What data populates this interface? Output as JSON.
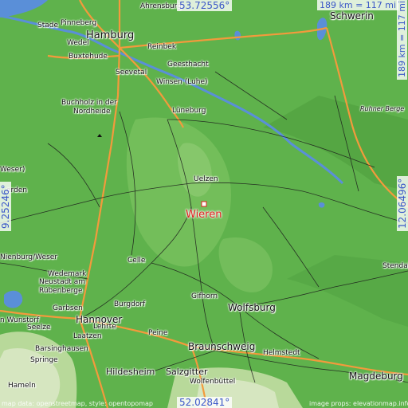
{
  "colors": {
    "land": "#5fb24c",
    "highland": "#8bc96a",
    "mountains": "#d6e6c0",
    "water": "#5a8fd8",
    "motorway": "#f39a3c",
    "road": "#1b1b1b",
    "accent": "#e0201c",
    "coord": "#3b57c8"
  },
  "location": {
    "name": "Wieren",
    "marker_icon": "square-marker-icon"
  },
  "coordinates": {
    "north": "53.72556°",
    "south": "52.02841°",
    "west": "9.25246°",
    "east": "12.06496°"
  },
  "scale": {
    "horizontal": "189 km = 117 mi",
    "vertical": "189 km = 117 mi"
  },
  "attribution": {
    "left": "map data: openstreetmap, style: opentopomap",
    "right": "image props: elevationmap.info"
  },
  "places": [
    {
      "name": "Ahrensburg",
      "size": "s9"
    },
    {
      "name": "Stade",
      "size": "s9"
    },
    {
      "name": "Pinneberg",
      "size": "s9"
    },
    {
      "name": "Hamburg",
      "size": "s13"
    },
    {
      "name": "Schwerin",
      "size": "s12"
    },
    {
      "name": "Wedel",
      "size": "s9"
    },
    {
      "name": "Buxtehude",
      "size": "s9"
    },
    {
      "name": "Reinbek",
      "size": "s9"
    },
    {
      "name": "Geesthacht",
      "size": "s9"
    },
    {
      "name": "Seevetal",
      "size": "s9"
    },
    {
      "name": "Winsen (Luhe)",
      "size": "s9"
    },
    {
      "name": "Buchholz in der",
      "size": "s9"
    },
    {
      "name": "Nordheide",
      "size": "s9"
    },
    {
      "name": "Lüneburg",
      "size": "s9"
    },
    {
      "name": "Ruhner Berge",
      "size": "s8"
    },
    {
      "name": "Weser)",
      "size": "s9"
    },
    {
      "name": "erden",
      "size": "s9"
    },
    {
      "name": "Uelzen",
      "size": "s9"
    },
    {
      "name": "Nienburg/Weser",
      "size": "s9"
    },
    {
      "name": "Celle",
      "size": "s9"
    },
    {
      "name": "Stendal",
      "size": "s9"
    },
    {
      "name": "Wedemark",
      "size": "s9"
    },
    {
      "name": "Neustadt am",
      "size": "s9"
    },
    {
      "name": "Rübenberge",
      "size": "s9"
    },
    {
      "name": "Gifhorn",
      "size": "s9"
    },
    {
      "name": "Garbsen",
      "size": "s9"
    },
    {
      "name": "Burgdorf",
      "size": "s9"
    },
    {
      "name": "Wolfsburg",
      "size": "s12"
    },
    {
      "name": "Hannover",
      "size": "s12"
    },
    {
      "name": "n Wunstorf",
      "size": "s9"
    },
    {
      "name": "Seelze",
      "size": "s9"
    },
    {
      "name": "Lehrte",
      "size": "s9"
    },
    {
      "name": "Laatzen",
      "size": "s9"
    },
    {
      "name": "Barsinghausen",
      "size": "s9"
    },
    {
      "name": "Peine",
      "size": "s9"
    },
    {
      "name": "Braunschweig",
      "size": "s12"
    },
    {
      "name": "Helmstedt",
      "size": "s9"
    },
    {
      "name": "Springe",
      "size": "s9"
    },
    {
      "name": "Hildesheim",
      "size": "s11"
    },
    {
      "name": "Salzgitter",
      "size": "s11"
    },
    {
      "name": "Wolfenbüttel",
      "size": "s9"
    },
    {
      "name": "Magdeburg",
      "size": "s12"
    },
    {
      "name": "Hameln",
      "size": "s9"
    }
  ]
}
